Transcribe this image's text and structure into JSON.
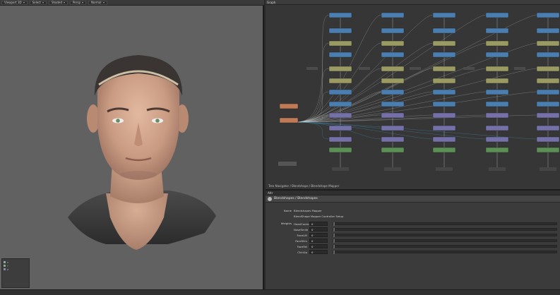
{
  "viewport": {
    "toolbar": [
      {
        "label": "Viewport 3D"
      },
      {
        "label": "Select"
      },
      {
        "label": "Shaded"
      },
      {
        "label": "Persp"
      },
      {
        "label": "Normal"
      }
    ],
    "gizmo_lines": [
      "X",
      "Y",
      "Z",
      "",
      "",
      "",
      "",
      ""
    ]
  },
  "graph": {
    "title": "Graph",
    "footer": "Tree Navigator / Blendshape / Blendshape Mapper",
    "colors": {
      "blue": "#4a7eb1",
      "olive": "#9a9a63",
      "purple": "#7470a8",
      "green": "#5c8f55",
      "orange": "#c07a55",
      "wire": "#c8c8c8",
      "wire_cyan": "#3fa9d9"
    },
    "columns": 5
  },
  "properties": {
    "tab": "Attr",
    "header": "Blendshapes / Blendshapes",
    "name_label": "Name",
    "name_value": "Blendshapes Mapper",
    "node_label": "Node",
    "node_value": "BlendShape Mapper Controller Setup",
    "weights_label": "Weights",
    "rows": [
      {
        "label": "HeadCorrective",
        "value": "0"
      },
      {
        "label": "NoseSmile",
        "value": "0"
      },
      {
        "label": "FaceLift",
        "value": "0"
      },
      {
        "label": "FaceSlim",
        "value": "0"
      },
      {
        "label": "FaceFat",
        "value": "0"
      },
      {
        "label": "ChinUp",
        "value": "0"
      }
    ]
  }
}
